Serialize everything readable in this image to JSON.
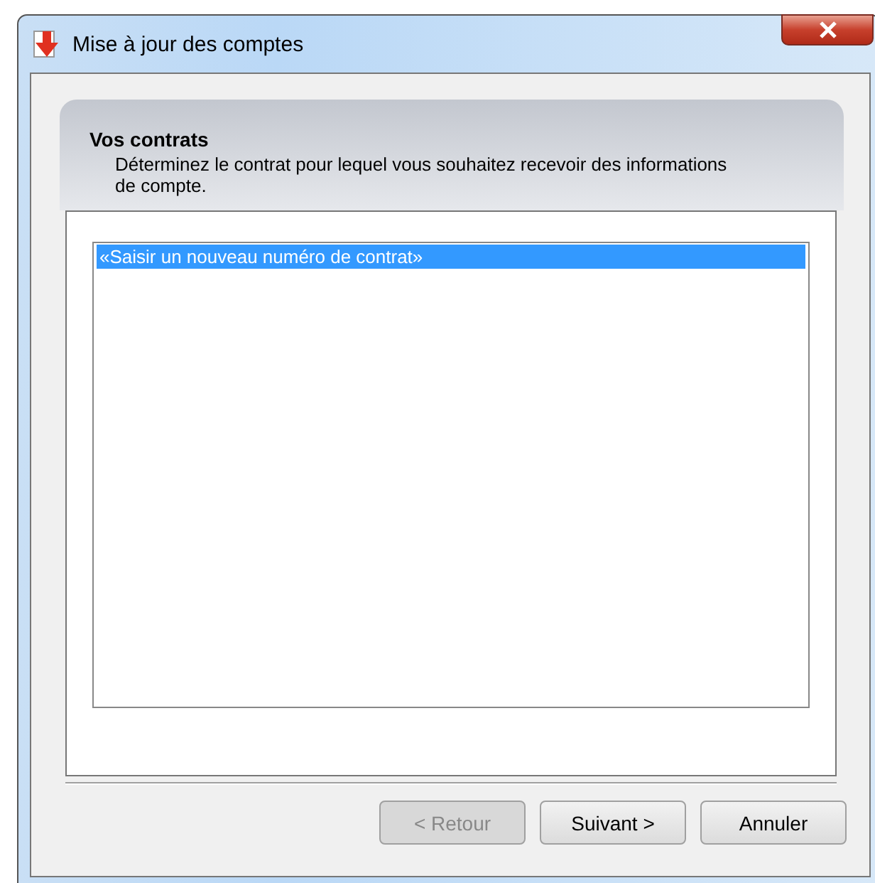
{
  "window": {
    "title": "Mise à jour des comptes"
  },
  "header": {
    "title": "Vos contrats",
    "description": "Déterminez le contrat pour lequel vous souhaitez recevoir des informations de compte."
  },
  "contracts": [
    {
      "label": "«Saisir un nouveau numéro de contrat»",
      "selected": true
    }
  ],
  "buttons": [
    {
      "label": "< Retour",
      "disabled": true
    },
    {
      "label": "Suivant >",
      "disabled": false
    },
    {
      "label": "Annuler",
      "disabled": false
    }
  ]
}
